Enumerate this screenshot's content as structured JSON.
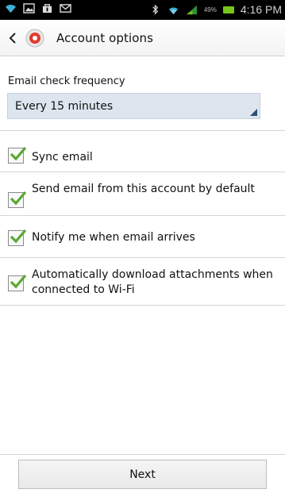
{
  "status_bar": {
    "battery_percent": "49%",
    "time": "4:16 PM",
    "icons": [
      "wifi-icon",
      "image-icon",
      "bag-icon",
      "mail-icon",
      "bluetooth-icon",
      "wifi-signal-icon",
      "cell-signal-icon",
      "battery-icon"
    ]
  },
  "action_bar": {
    "title": "Account options",
    "app_icon": "email-app-icon"
  },
  "settings": {
    "frequency_label": "Email check frequency",
    "frequency_value": "Every 15 minutes",
    "options": [
      {
        "label": "Sync email",
        "checked": true
      },
      {
        "label": "Send email from this account by default",
        "checked": true
      },
      {
        "label": "Notify me when email arrives",
        "checked": true
      },
      {
        "label": "Automatically download attachments when connected to Wi-Fi",
        "checked": true
      }
    ]
  },
  "footer": {
    "next_label": "Next"
  },
  "colors": {
    "status_bar_bg": "#000000",
    "spinner_bg": "#dde6ef",
    "check_green": "#5aa832",
    "battery_green": "#79c51b"
  }
}
